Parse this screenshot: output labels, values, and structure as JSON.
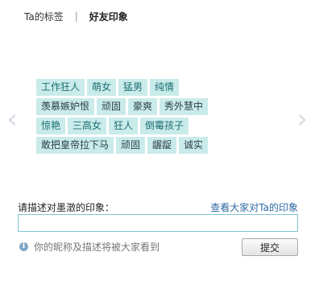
{
  "tabs": [
    {
      "label": "Ta的标签"
    },
    {
      "label": "好友印象"
    }
  ],
  "tab_separator": "|",
  "nav": {
    "prev": "‹",
    "next": "›"
  },
  "impressions": {
    "rows": [
      [
        "工作狂人",
        "萌女",
        "猛男",
        "纯情"
      ],
      [
        "羡慕嫉妒恨",
        "顽固",
        "豪爽",
        "秀外慧中"
      ],
      [
        "惊艳",
        "三高女",
        "狂人",
        "倒霉孩子"
      ],
      [
        "敢把皇帝拉下马",
        "顽固",
        "龌龊",
        "诚实"
      ]
    ]
  },
  "form": {
    "prompt_label": "请描述对墨澂的印象：",
    "view_all_link": "查看大家对Ta的印象",
    "input_value": "",
    "input_placeholder": "",
    "notice": "你的昵称及描述将被大家看到",
    "submit_label": "提交"
  },
  "colors": {
    "tag_bg": "#c9ebea",
    "tag_text": "#1c6f73",
    "link": "#2f6aa3",
    "input_border": "#7ec4d6"
  }
}
